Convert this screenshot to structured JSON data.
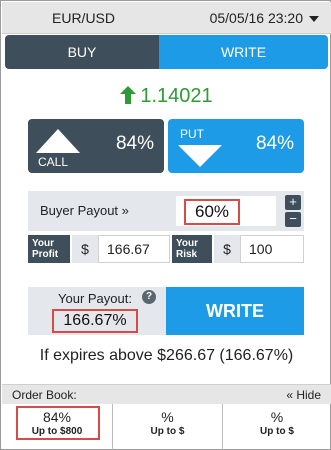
{
  "header": {
    "pair": "EUR/USD",
    "datetime": "05/05/16 23:20"
  },
  "tabs": [
    {
      "label": "BUY"
    },
    {
      "label": "WRITE"
    }
  ],
  "price": {
    "value": "1.14021"
  },
  "options": {
    "call": {
      "label": "CALL",
      "percent": "84%"
    },
    "put": {
      "label": "PUT",
      "percent": "84%"
    }
  },
  "buyer_payout": {
    "label": "Buyer Payout »",
    "value": "60%",
    "plus": "+",
    "minus": "−"
  },
  "profit": {
    "label_line1": "Your",
    "label_line2": "Profit",
    "currency": "$",
    "value": "166.67"
  },
  "risk": {
    "label_line1": "Your",
    "label_line2": "Risk",
    "currency": "$",
    "value": "100"
  },
  "your_payout": {
    "label": "Your Payout:",
    "help": "?",
    "value": "166.67%"
  },
  "write_button": {
    "label": "WRITE"
  },
  "expires_text": "If expires above $266.67 (166.67%)",
  "order_book": {
    "label": "Order Book:",
    "hide": "« Hide",
    "entries": [
      {
        "percent": "84%",
        "sub": "Up to $800"
      },
      {
        "percent": "%",
        "sub": "Up to $"
      },
      {
        "percent": "%",
        "sub": "Up to $"
      }
    ]
  },
  "colors": {
    "dark": "#3f4e5b",
    "blue": "#1e9be6",
    "green": "#2d9b36",
    "highlight": "#d84b4b"
  }
}
